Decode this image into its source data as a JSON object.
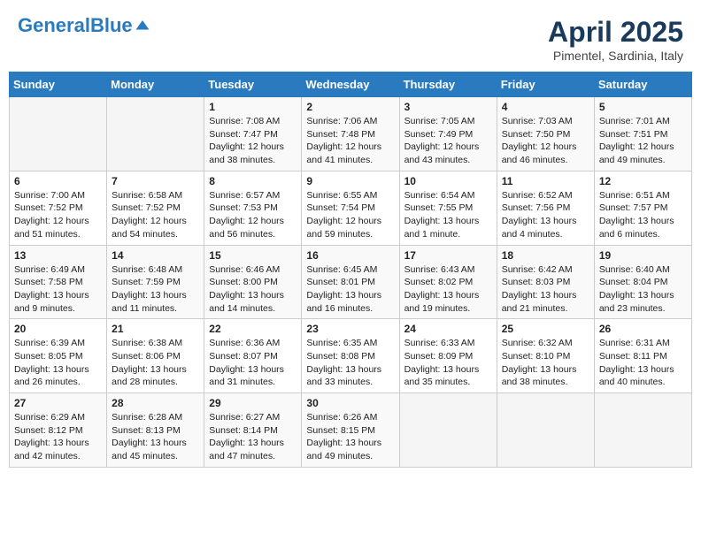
{
  "header": {
    "logo_general": "General",
    "logo_blue": "Blue",
    "month_title": "April 2025",
    "subtitle": "Pimentel, Sardinia, Italy"
  },
  "days_of_week": [
    "Sunday",
    "Monday",
    "Tuesday",
    "Wednesday",
    "Thursday",
    "Friday",
    "Saturday"
  ],
  "weeks": [
    [
      {
        "day": "",
        "info": ""
      },
      {
        "day": "",
        "info": ""
      },
      {
        "day": "1",
        "info": "Sunrise: 7:08 AM\nSunset: 7:47 PM\nDaylight: 12 hours and 38 minutes."
      },
      {
        "day": "2",
        "info": "Sunrise: 7:06 AM\nSunset: 7:48 PM\nDaylight: 12 hours and 41 minutes."
      },
      {
        "day": "3",
        "info": "Sunrise: 7:05 AM\nSunset: 7:49 PM\nDaylight: 12 hours and 43 minutes."
      },
      {
        "day": "4",
        "info": "Sunrise: 7:03 AM\nSunset: 7:50 PM\nDaylight: 12 hours and 46 minutes."
      },
      {
        "day": "5",
        "info": "Sunrise: 7:01 AM\nSunset: 7:51 PM\nDaylight: 12 hours and 49 minutes."
      }
    ],
    [
      {
        "day": "6",
        "info": "Sunrise: 7:00 AM\nSunset: 7:52 PM\nDaylight: 12 hours and 51 minutes."
      },
      {
        "day": "7",
        "info": "Sunrise: 6:58 AM\nSunset: 7:52 PM\nDaylight: 12 hours and 54 minutes."
      },
      {
        "day": "8",
        "info": "Sunrise: 6:57 AM\nSunset: 7:53 PM\nDaylight: 12 hours and 56 minutes."
      },
      {
        "day": "9",
        "info": "Sunrise: 6:55 AM\nSunset: 7:54 PM\nDaylight: 12 hours and 59 minutes."
      },
      {
        "day": "10",
        "info": "Sunrise: 6:54 AM\nSunset: 7:55 PM\nDaylight: 13 hours and 1 minute."
      },
      {
        "day": "11",
        "info": "Sunrise: 6:52 AM\nSunset: 7:56 PM\nDaylight: 13 hours and 4 minutes."
      },
      {
        "day": "12",
        "info": "Sunrise: 6:51 AM\nSunset: 7:57 PM\nDaylight: 13 hours and 6 minutes."
      }
    ],
    [
      {
        "day": "13",
        "info": "Sunrise: 6:49 AM\nSunset: 7:58 PM\nDaylight: 13 hours and 9 minutes."
      },
      {
        "day": "14",
        "info": "Sunrise: 6:48 AM\nSunset: 7:59 PM\nDaylight: 13 hours and 11 minutes."
      },
      {
        "day": "15",
        "info": "Sunrise: 6:46 AM\nSunset: 8:00 PM\nDaylight: 13 hours and 14 minutes."
      },
      {
        "day": "16",
        "info": "Sunrise: 6:45 AM\nSunset: 8:01 PM\nDaylight: 13 hours and 16 minutes."
      },
      {
        "day": "17",
        "info": "Sunrise: 6:43 AM\nSunset: 8:02 PM\nDaylight: 13 hours and 19 minutes."
      },
      {
        "day": "18",
        "info": "Sunrise: 6:42 AM\nSunset: 8:03 PM\nDaylight: 13 hours and 21 minutes."
      },
      {
        "day": "19",
        "info": "Sunrise: 6:40 AM\nSunset: 8:04 PM\nDaylight: 13 hours and 23 minutes."
      }
    ],
    [
      {
        "day": "20",
        "info": "Sunrise: 6:39 AM\nSunset: 8:05 PM\nDaylight: 13 hours and 26 minutes."
      },
      {
        "day": "21",
        "info": "Sunrise: 6:38 AM\nSunset: 8:06 PM\nDaylight: 13 hours and 28 minutes."
      },
      {
        "day": "22",
        "info": "Sunrise: 6:36 AM\nSunset: 8:07 PM\nDaylight: 13 hours and 31 minutes."
      },
      {
        "day": "23",
        "info": "Sunrise: 6:35 AM\nSunset: 8:08 PM\nDaylight: 13 hours and 33 minutes."
      },
      {
        "day": "24",
        "info": "Sunrise: 6:33 AM\nSunset: 8:09 PM\nDaylight: 13 hours and 35 minutes."
      },
      {
        "day": "25",
        "info": "Sunrise: 6:32 AM\nSunset: 8:10 PM\nDaylight: 13 hours and 38 minutes."
      },
      {
        "day": "26",
        "info": "Sunrise: 6:31 AM\nSunset: 8:11 PM\nDaylight: 13 hours and 40 minutes."
      }
    ],
    [
      {
        "day": "27",
        "info": "Sunrise: 6:29 AM\nSunset: 8:12 PM\nDaylight: 13 hours and 42 minutes."
      },
      {
        "day": "28",
        "info": "Sunrise: 6:28 AM\nSunset: 8:13 PM\nDaylight: 13 hours and 45 minutes."
      },
      {
        "day": "29",
        "info": "Sunrise: 6:27 AM\nSunset: 8:14 PM\nDaylight: 13 hours and 47 minutes."
      },
      {
        "day": "30",
        "info": "Sunrise: 6:26 AM\nSunset: 8:15 PM\nDaylight: 13 hours and 49 minutes."
      },
      {
        "day": "",
        "info": ""
      },
      {
        "day": "",
        "info": ""
      },
      {
        "day": "",
        "info": ""
      }
    ]
  ]
}
